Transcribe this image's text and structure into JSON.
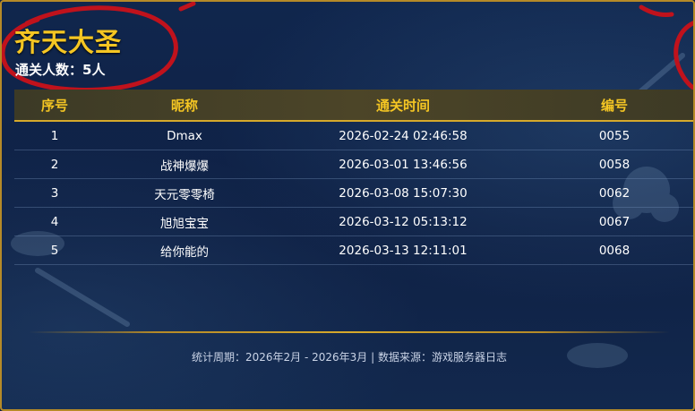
{
  "header": {
    "title": "齐天大圣",
    "clear_count": "通关人数：5人"
  },
  "table": {
    "columns": [
      "序号",
      "昵称",
      "通关时间",
      "编号"
    ],
    "rows": [
      {
        "rank": "1",
        "nickname": "Dmax",
        "time": "2026-02-24 02:46:58",
        "id": "0055"
      },
      {
        "rank": "2",
        "nickname": "战神爆爆",
        "time": "2026-03-01 13:46:56",
        "id": "0058"
      },
      {
        "rank": "3",
        "nickname": "天元零零椅",
        "time": "2026-03-08 15:07:30",
        "id": "0062"
      },
      {
        "rank": "4",
        "nickname": "旭旭宝宝",
        "time": "2026-03-12 05:13:12",
        "id": "0067"
      },
      {
        "rank": "5",
        "nickname": "给你能的",
        "time": "2026-03-13 12:11:01",
        "id": "0068"
      }
    ]
  },
  "footer": {
    "text": "统计周期：2026年2月 - 2026年3月 | 数据来源：游戏服务器日志"
  },
  "colors": {
    "accent_gold": "#f5c623",
    "border_gold": "#b58a28",
    "background": "#0f2246",
    "annotation_red": "#c0121c"
  },
  "annotations": [
    "red-circle-marker"
  ]
}
